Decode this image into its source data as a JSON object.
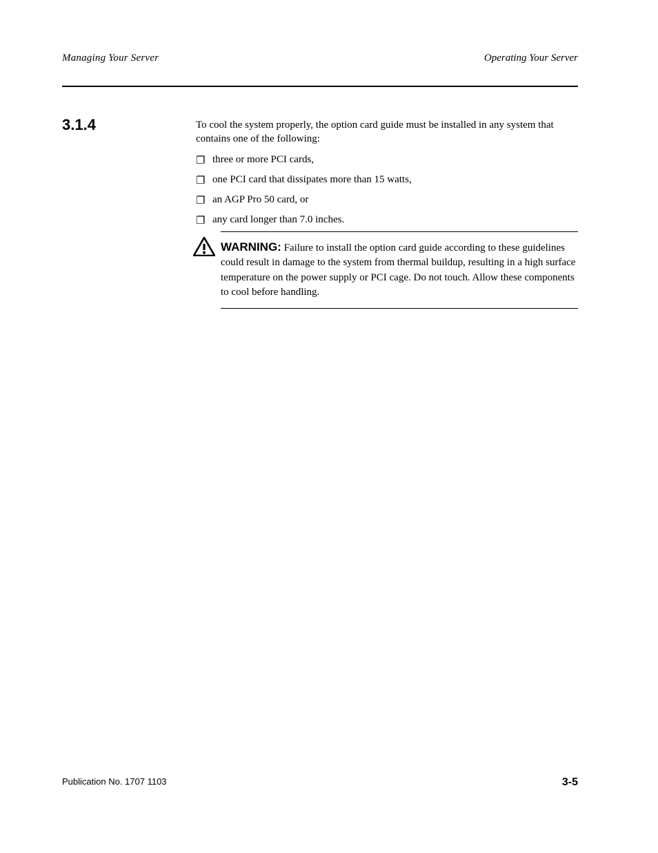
{
  "header": {
    "left": "Managing Your Server",
    "right": "Operating Your Server"
  },
  "section_number": "3.1.4",
  "intro": "To cool the system properly, the option card guide must be installed in any system that contains one of the following:",
  "bullets": [
    "three or more PCI cards,",
    "one PCI card that dissipates more than 15 watts,",
    "an AGP Pro 50 card, or",
    "any card longer than 7.0 inches."
  ],
  "callout": {
    "heading": "WARNING:",
    "body": "Failure to install the option card guide according to these guidelines could result in damage to the system from thermal buildup, resulting in a high surface temperature on the power supply or PCI cage. Do not touch. Allow these components to cool before handling."
  },
  "footer": {
    "left": "Publication No. 1707 1103",
    "right": "3-5"
  }
}
